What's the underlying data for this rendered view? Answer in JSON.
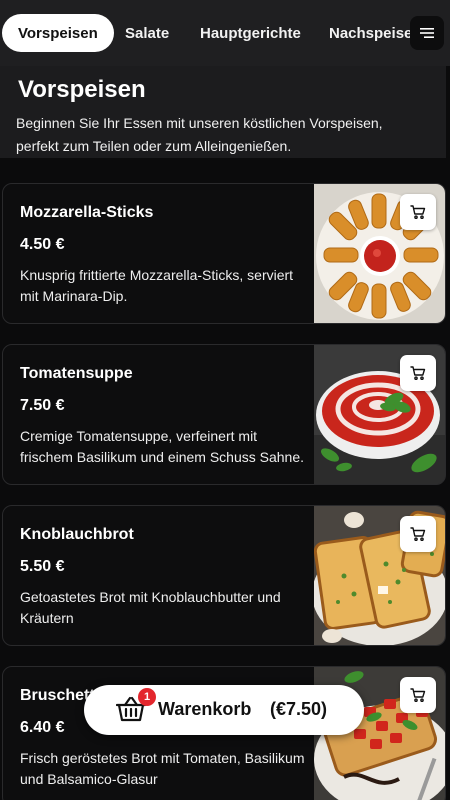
{
  "tabs": [
    {
      "label": "Vorspeisen",
      "active": true
    },
    {
      "label": "Salate",
      "active": false
    },
    {
      "label": "Hauptgerichte",
      "active": false
    },
    {
      "label": "Nachspeise",
      "active": false
    }
  ],
  "menu_icon": "hamburger-menu-icon",
  "section": {
    "title": "Vorspeisen",
    "description": "Beginnen Sie Ihr Essen mit unseren köstlichen Vorspeisen, perfekt zum Teilen oder zum Alleingenießen."
  },
  "items": [
    {
      "name": "Mozzarella-Sticks",
      "price": "4.50 €",
      "description": "Knusprig frittierte Mozzarella-Sticks, serviert mit Marinara-Dip."
    },
    {
      "name": "Tomatensuppe",
      "price": "7.50 €",
      "description": "Cremige Tomatensuppe, verfeinert mit frischem Basilikum und einem Schuss Sahne."
    },
    {
      "name": "Knoblauchbrot",
      "price": "5.50 €",
      "description": "Getoastetes Brot mit Knoblauchbutter und Kräutern"
    },
    {
      "name": "Bruschetta",
      "price": "6.40 €",
      "description": "Frisch geröstetes Brot mit Tomaten, Basilikum und Balsamico-Glasur"
    }
  ],
  "cart": {
    "label": "Warenkorb",
    "total": "(€7.50)",
    "count": "1"
  },
  "colors": {
    "background": "#0b0b0c",
    "badge": "#e3262d",
    "active_tab": "#ffffff"
  }
}
